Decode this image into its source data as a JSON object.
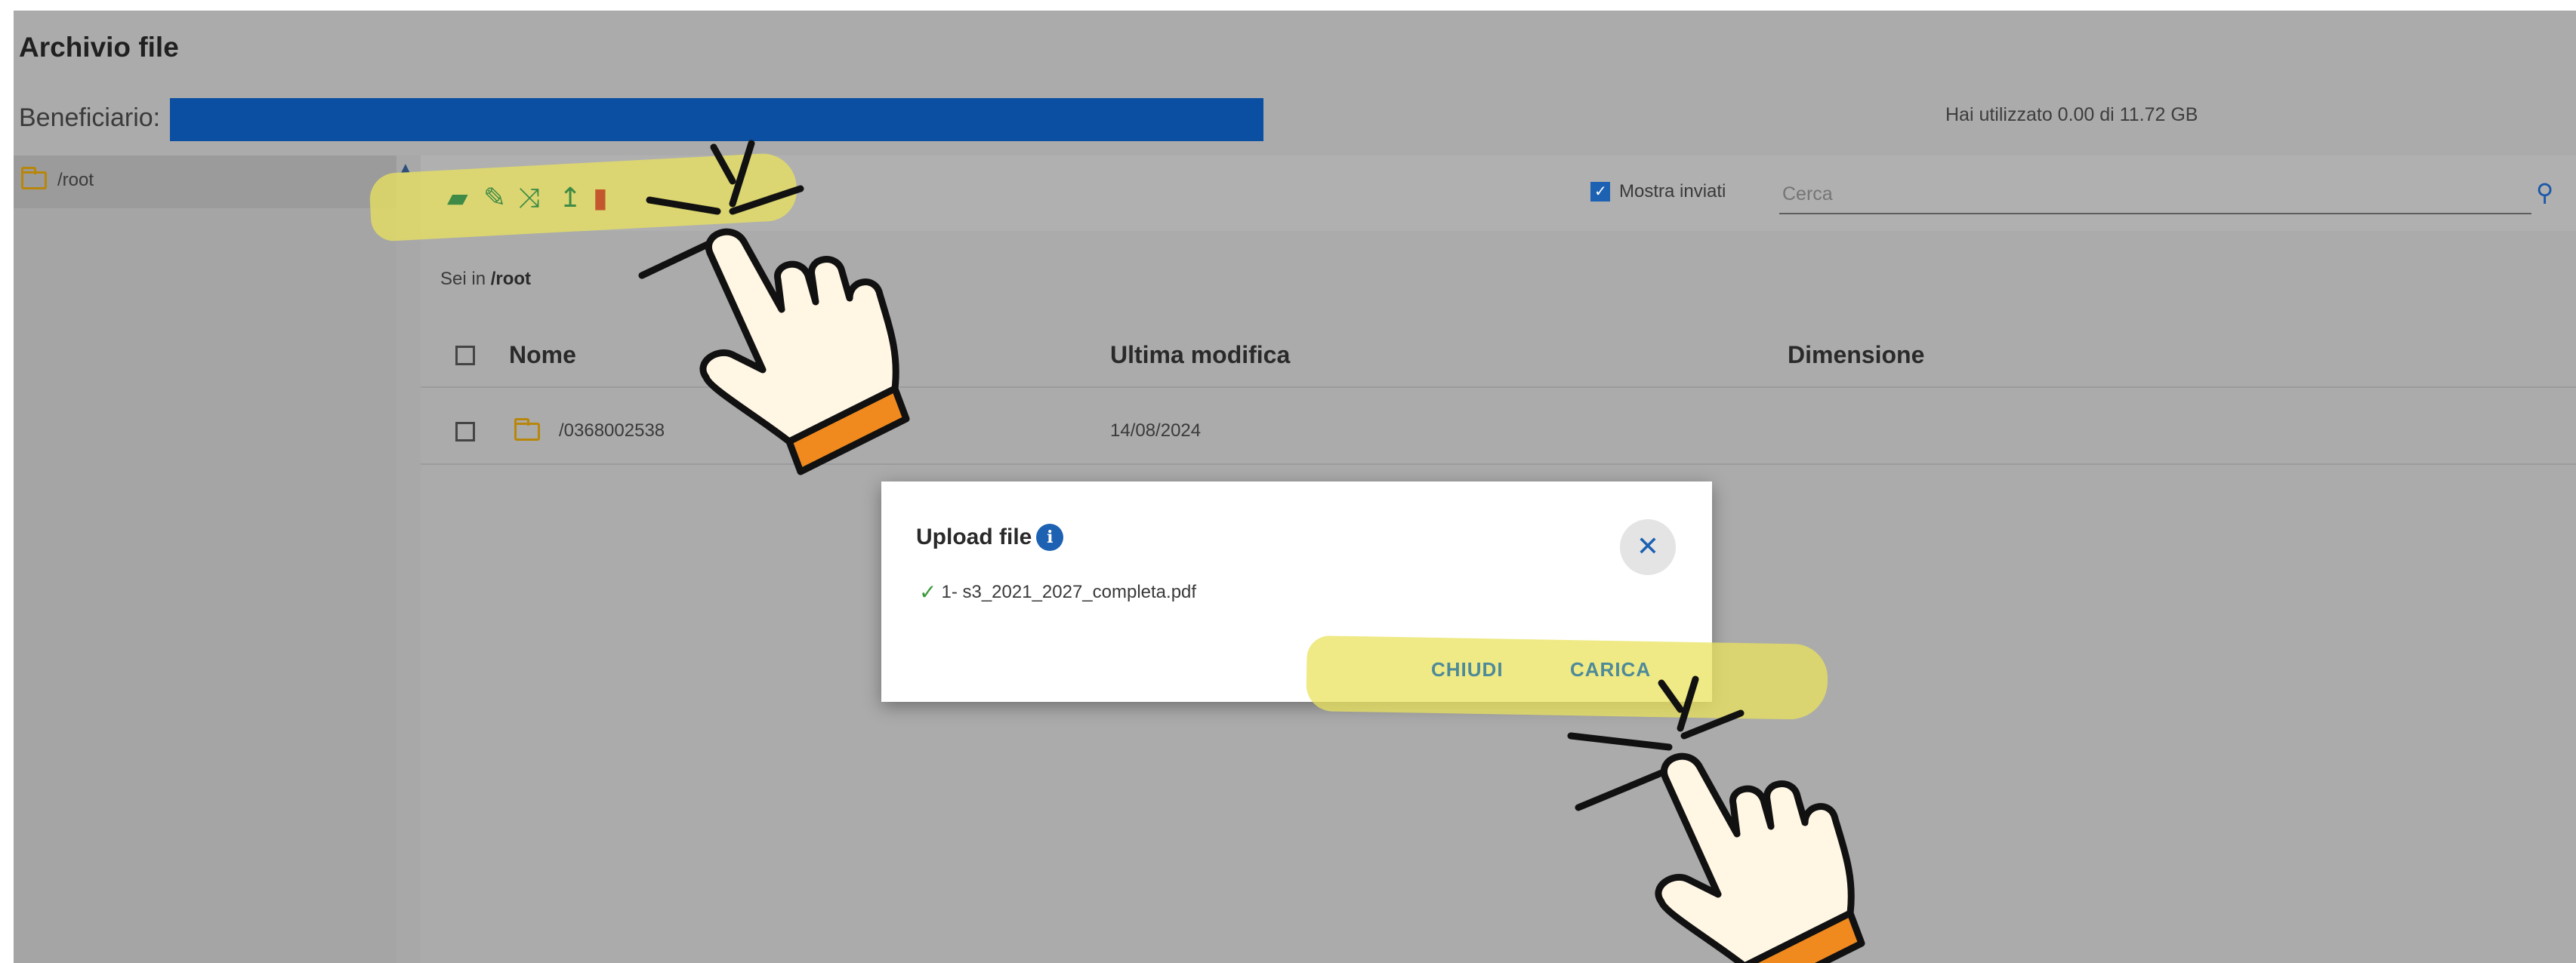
{
  "header": {
    "title": "Archivio file",
    "beneficiary_label": "Beneficiario:",
    "usage_text": "Hai utilizzato 0.00 di 11.72 GB"
  },
  "sidebar": {
    "items": [
      {
        "label": "/root",
        "icon": "folder-icon",
        "selected": true
      }
    ]
  },
  "toolbar": {
    "icons": [
      "new-folder-icon",
      "edit-icon",
      "move-icon",
      "upload-icon",
      "delete-icon"
    ],
    "show_sent_label": "Mostra inviati",
    "show_sent_checked": true,
    "search_placeholder": "Cerca",
    "search_icon": "search-icon"
  },
  "breadcrumb": {
    "prefix": "Sei in",
    "current": "/root"
  },
  "table": {
    "columns": [
      "Nome",
      "Ultima modifica",
      "Dimensione"
    ],
    "rows": [
      {
        "name": "/03680025​38",
        "modified": "14/08/2024",
        "size": ""
      }
    ]
  },
  "modal": {
    "title": "Upload file",
    "file_name": "1- s3_2021_2027_completa.pdf",
    "close_button_icon": "close-icon",
    "buttons": {
      "close": "CHIUDI",
      "upload": "CARICA"
    }
  },
  "colors": {
    "accent": "#1d61b3",
    "beneficiary_bar": "#0a4fa1",
    "highlight": "#e9e35c",
    "hand_cuff": "#f08a1f"
  }
}
